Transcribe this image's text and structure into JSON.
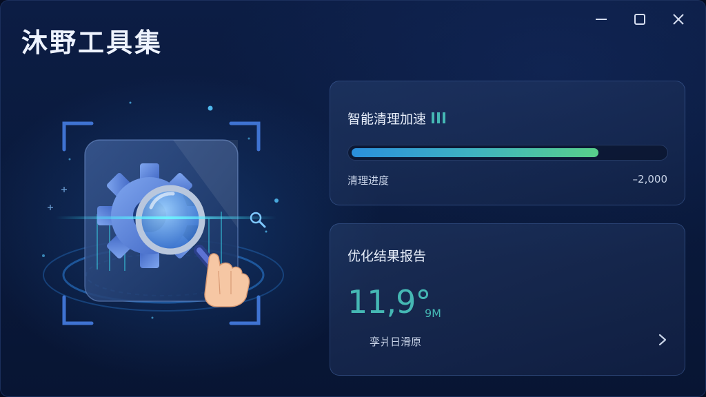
{
  "app": {
    "title": "沐野工具集"
  },
  "window_controls": {
    "minimize_icon": "minimize-icon",
    "maximize_icon": "maximize-icon",
    "close_icon": "close-icon"
  },
  "illustration": {
    "icon": "gear-magnifier-hand-illustration"
  },
  "clean_card": {
    "title": "智能清理加速",
    "title_icon": "signal-bars-icon",
    "progress_label": "清理进度",
    "progress_value": "–2,000",
    "progress_fraction": 0.79,
    "colors": {
      "bar_start": "#2a8fdc",
      "bar_end": "#58d08a",
      "icon": "#45b8b4"
    }
  },
  "report_card": {
    "title": "优化结果报告",
    "result_value": "11,9°",
    "result_unit": "9M",
    "caption": "孪爿日滑原",
    "chevron_icon": "chevron-right-icon",
    "accent_color": "#45b8b4"
  }
}
